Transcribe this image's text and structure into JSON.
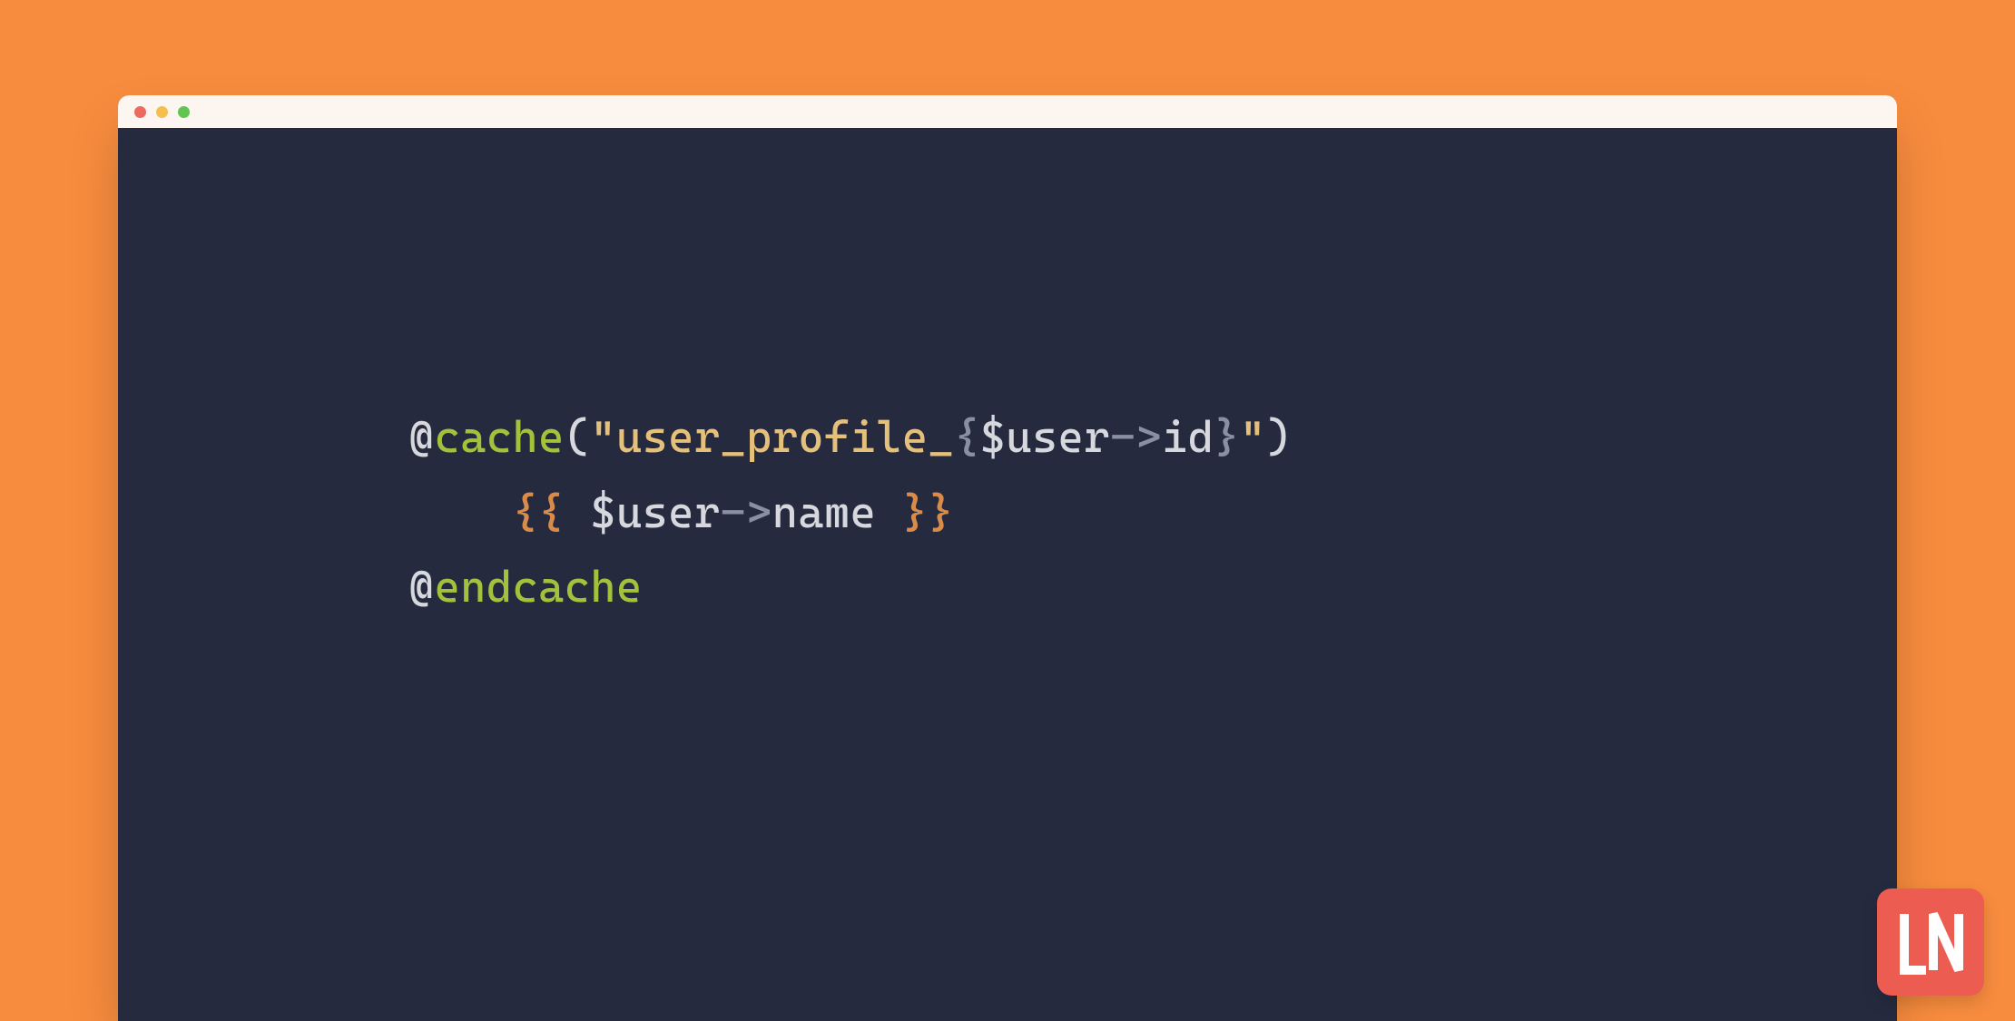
{
  "colors": {
    "background": "#f78c3e",
    "window_bg": "#252a3f",
    "titlebar_bg": "#fdf5ef",
    "traffic_red": "#ed6a5f",
    "traffic_yellow": "#f5bf4f",
    "traffic_green": "#61c554",
    "token_default": "#d6d8dd",
    "token_green": "#a2c23c",
    "token_yellow": "#e4c07a",
    "token_muted": "#8a90a3",
    "token_orange": "#d98b4b",
    "logo_bg": "#ec5c51",
    "logo_fg": "#ffffff"
  },
  "logo_text": "LN",
  "code": {
    "line1": {
      "at": "@",
      "directive": "cache",
      "paren_open": "(",
      "str_open": "\"",
      "str_literal": "user_profile_",
      "interp_open": "{",
      "var": "$user",
      "arrow": "->",
      "prop": "id",
      "interp_close": "}",
      "str_close": "\"",
      "paren_close": ")"
    },
    "line2": {
      "indent": "    ",
      "blade_open": "{{ ",
      "var": "$user",
      "arrow": "->",
      "prop": "name",
      "blade_close": " }}"
    },
    "line3": {
      "at": "@",
      "directive": "endcache"
    }
  }
}
